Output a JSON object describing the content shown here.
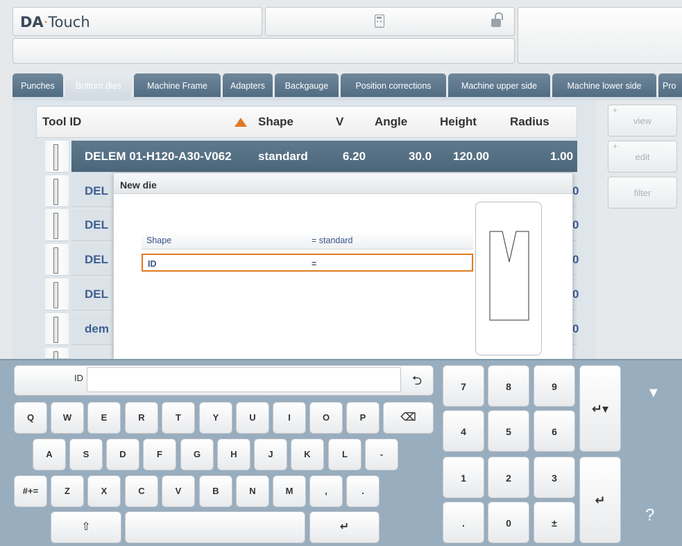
{
  "header": {
    "brand_prefix": "DA",
    "brand_suffix": "Touch"
  },
  "tabs": [
    {
      "label": "Punches"
    },
    {
      "label": "Bottom dies"
    },
    {
      "label": "Machine Frame"
    },
    {
      "label": "Adapters"
    },
    {
      "label": "Backgauge"
    },
    {
      "label": "Position corrections"
    },
    {
      "label": "Machine upper side"
    },
    {
      "label": "Machine lower side"
    },
    {
      "label": "Pro"
    }
  ],
  "table": {
    "columns": [
      "Tool ID",
      "Shape",
      "V",
      "Angle",
      "Height",
      "Radius"
    ],
    "rows": [
      {
        "id": "DELEM 01-H120-A30-V062",
        "shape": "standard",
        "v": "6.20",
        "angle": "30.0",
        "height": "120.00",
        "radius": "1.00",
        "selected": true
      },
      {
        "id": "DEL"
      },
      {
        "id": "DEL"
      },
      {
        "id": "DEL"
      },
      {
        "id": "DEL"
      },
      {
        "id": "dem"
      }
    ],
    "row_suffix": "0"
  },
  "side_buttons": {
    "view": "view",
    "edit": "edit",
    "filter": "filter",
    "plus": "+"
  },
  "dialog": {
    "title": "New die",
    "fields": [
      {
        "label": "Shape",
        "value": "= standard"
      },
      {
        "label": "ID",
        "value": "="
      }
    ]
  },
  "keyboard": {
    "input_label": "ID",
    "input_value": "",
    "undo": "⮌",
    "row1": [
      "Q",
      "W",
      "E",
      "R",
      "T",
      "Y",
      "U",
      "I",
      "O",
      "P"
    ],
    "backspace": "⌫",
    "row2": [
      "A",
      "S",
      "D",
      "F",
      "G",
      "H",
      "J",
      "K",
      "L",
      "-"
    ],
    "symbols": "#+=",
    "row3": [
      "Z",
      "X",
      "C",
      "V",
      "B",
      "N",
      "M",
      ",",
      "."
    ],
    "shift": "⇧",
    "enter": "↵",
    "numpad": [
      "7",
      "8",
      "9",
      "4",
      "5",
      "6",
      "1",
      "2",
      "3",
      ".",
      "0",
      "±"
    ],
    "hide": "▼",
    "help": "?"
  }
}
